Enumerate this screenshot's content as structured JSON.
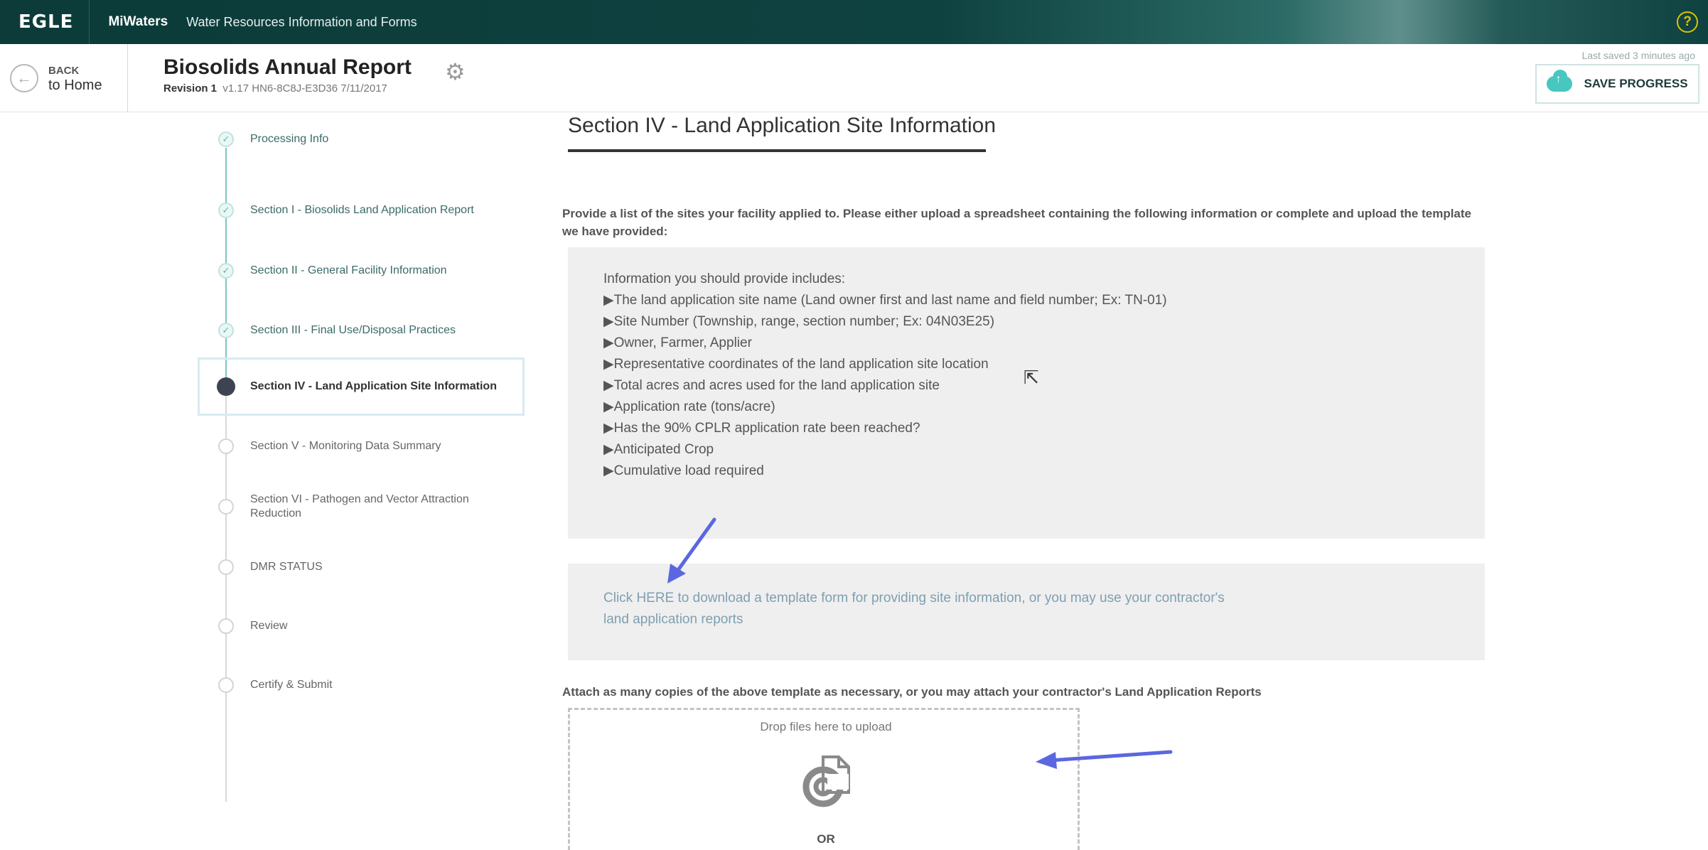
{
  "topbar": {
    "logo": "EGLE",
    "app_name": "MiWaters",
    "app_subtitle": "Water Resources Information and Forms",
    "help_icon": "?"
  },
  "header": {
    "back_small": "BACK",
    "back_big": "to Home",
    "report_title": "Biosolids Annual Report",
    "revision_label": "Revision 1",
    "report_meta": "v1.17   HN6-8C8J-E3D36   7/11/2017",
    "last_saved": "Last saved 3 minutes ago",
    "save_label": "SAVE PROGRESS"
  },
  "steps": [
    {
      "label": "Processing Info",
      "state": "done"
    },
    {
      "label": "Section I - Biosolids Land Application Report",
      "state": "done"
    },
    {
      "label": "Section II - General Facility Information",
      "state": "done"
    },
    {
      "label": "Section III - Final Use/Disposal Practices",
      "state": "done"
    },
    {
      "label": "Section IV - Land Application Site Information",
      "state": "active"
    },
    {
      "label": "Section V - Monitoring Data Summary",
      "state": "todo"
    },
    {
      "label": "Section VI - Pathogen and Vector Attraction Reduction",
      "state": "todo"
    },
    {
      "label": "DMR STATUS",
      "state": "todo"
    },
    {
      "label": "Review",
      "state": "todo"
    },
    {
      "label": "Certify & Submit",
      "state": "todo"
    }
  ],
  "main": {
    "section_title": "Section IV - Land Application Site Information",
    "intro": "Provide a list of the sites your facility applied to. Please either upload a spreadsheet containing the following information or complete and upload the template we have provided:",
    "info_heading": "Information you should provide includes:",
    "info_items": [
      "▶The land application site name (Land owner first and last name and field number; Ex: TN-01)",
      "▶Site Number (Township, range, section number; Ex: 04N03E25)",
      "▶Owner, Farmer, Applier",
      "▶Representative coordinates of the land application site location",
      "▶Total acres and acres used for the land application site",
      "▶Application rate (tons/acre)",
      "▶Has the 90% CPLR application rate been reached?",
      "▶Anticipated Crop",
      "▶Cumulative load required"
    ],
    "download_text": "Click HERE to download a template form for providing site information, or you may use your contractor's land application reports",
    "attach_text": "Attach as many copies of the above template as necessary, or you may attach your contractor's Land Application Reports",
    "drop_label": "Drop files here to upload",
    "or_label": "OR"
  }
}
